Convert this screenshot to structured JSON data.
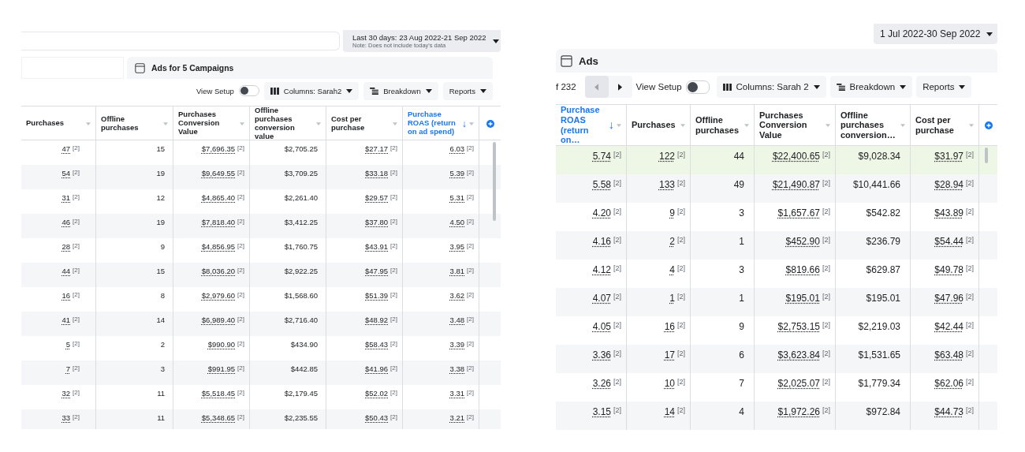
{
  "panels": [
    {
      "date_range": {
        "label": "Last 30 days: 23 Aug 2022-21 Sep 2022",
        "note": "Note: Does not include today's data"
      },
      "title": "Ads for 5 Campaigns",
      "view_setup": {
        "label": "View Setup",
        "on": false
      },
      "buttons": [
        "Columns: Sarah2",
        "Breakdown",
        "Reports"
      ],
      "columns": [
        {
          "label": "Purchases",
          "sorted": false
        },
        {
          "label": "Offline purchases",
          "sorted": false
        },
        {
          "label": "Purchases Conversion Value",
          "sorted": false
        },
        {
          "label": "Offline purchases conversion value",
          "sorted": false
        },
        {
          "label": "Cost per purchase",
          "sorted": false
        },
        {
          "label": "Purchase ROAS (return on ad spend)",
          "sorted": true,
          "arrow": "↓"
        }
      ],
      "rows": [
        {
          "selected": false,
          "cells": [
            {
              "v": "47",
              "n": "[2]"
            },
            {
              "v": "15"
            },
            {
              "v": "$7,696.35",
              "n": "[2]"
            },
            {
              "v": "$2,705.25"
            },
            {
              "v": "$27.17",
              "n": "[2]"
            },
            {
              "v": "6.03",
              "n": "[2]"
            }
          ]
        },
        {
          "selected": false,
          "cells": [
            {
              "v": "54",
              "n": "[2]"
            },
            {
              "v": "19"
            },
            {
              "v": "$9,649.55",
              "n": "[2]"
            },
            {
              "v": "$3,709.25"
            },
            {
              "v": "$33.18",
              "n": "[2]"
            },
            {
              "v": "5.39",
              "n": "[2]"
            }
          ]
        },
        {
          "selected": false,
          "cells": [
            {
              "v": "31",
              "n": "[2]"
            },
            {
              "v": "12"
            },
            {
              "v": "$4,865.40",
              "n": "[2]"
            },
            {
              "v": "$2,261.40"
            },
            {
              "v": "$29.57",
              "n": "[2]"
            },
            {
              "v": "5.31",
              "n": "[2]"
            }
          ]
        },
        {
          "selected": false,
          "cells": [
            {
              "v": "46",
              "n": "[2]"
            },
            {
              "v": "19"
            },
            {
              "v": "$7,818.40",
              "n": "[2]"
            },
            {
              "v": "$3,412.25"
            },
            {
              "v": "$37.80",
              "n": "[2]"
            },
            {
              "v": "4.50",
              "n": "[2]"
            }
          ]
        },
        {
          "selected": false,
          "cells": [
            {
              "v": "28",
              "n": "[2]"
            },
            {
              "v": "9"
            },
            {
              "v": "$4,856.95",
              "n": "[2]"
            },
            {
              "v": "$1,760.75"
            },
            {
              "v": "$43.91",
              "n": "[2]"
            },
            {
              "v": "3.95",
              "n": "[2]"
            }
          ]
        },
        {
          "selected": false,
          "cells": [
            {
              "v": "44",
              "n": "[2]"
            },
            {
              "v": "15"
            },
            {
              "v": "$8,036.20",
              "n": "[2]"
            },
            {
              "v": "$2,922.25"
            },
            {
              "v": "$47.95",
              "n": "[2]"
            },
            {
              "v": "3.81",
              "n": "[2]"
            }
          ]
        },
        {
          "selected": false,
          "cells": [
            {
              "v": "16",
              "n": "[2]"
            },
            {
              "v": "8"
            },
            {
              "v": "$2,979.60",
              "n": "[2]"
            },
            {
              "v": "$1,568.60"
            },
            {
              "v": "$51.39",
              "n": "[2]"
            },
            {
              "v": "3.62",
              "n": "[2]"
            }
          ]
        },
        {
          "selected": false,
          "cells": [
            {
              "v": "41",
              "n": "[2]"
            },
            {
              "v": "14"
            },
            {
              "v": "$6,989.40",
              "n": "[2]"
            },
            {
              "v": "$2,716.40"
            },
            {
              "v": "$48.92",
              "n": "[2]"
            },
            {
              "v": "3.48",
              "n": "[2]"
            }
          ]
        },
        {
          "selected": false,
          "cells": [
            {
              "v": "5",
              "n": "[2]"
            },
            {
              "v": "2"
            },
            {
              "v": "$990.90",
              "n": "[2]"
            },
            {
              "v": "$434.90"
            },
            {
              "v": "$58.43",
              "n": "[2]"
            },
            {
              "v": "3.39",
              "n": "[2]"
            }
          ]
        },
        {
          "selected": false,
          "cells": [
            {
              "v": "7",
              "n": "[2]"
            },
            {
              "v": "3"
            },
            {
              "v": "$991.95",
              "n": "[2]"
            },
            {
              "v": "$442.85"
            },
            {
              "v": "$41.96",
              "n": "[2]"
            },
            {
              "v": "3.38",
              "n": "[2]"
            }
          ]
        },
        {
          "selected": false,
          "cells": [
            {
              "v": "32",
              "n": "[2]"
            },
            {
              "v": "11"
            },
            {
              "v": "$5,518.45",
              "n": "[2]"
            },
            {
              "v": "$2,179.45"
            },
            {
              "v": "$52.02",
              "n": "[2]"
            },
            {
              "v": "3.31",
              "n": "[2]"
            }
          ]
        },
        {
          "selected": false,
          "cells": [
            {
              "v": "33",
              "n": "[2]"
            },
            {
              "v": "11"
            },
            {
              "v": "$5,348.65",
              "n": "[2]"
            },
            {
              "v": "$2,235.55"
            },
            {
              "v": "$50.43",
              "n": "[2]"
            },
            {
              "v": "3.21",
              "n": "[2]"
            }
          ]
        }
      ]
    },
    {
      "date_range": {
        "label": "1 Jul 2022-30 Sep 2022"
      },
      "title": "Ads",
      "pager": {
        "label": "f 232",
        "prev_disabled": true
      },
      "view_setup": {
        "label": "View Setup",
        "on": false
      },
      "buttons": [
        "Columns: Sarah 2",
        "Breakdown",
        "Reports"
      ],
      "columns": [
        {
          "label": "Purchase ROAS (return on…",
          "sorted": true,
          "arrow": "↓"
        },
        {
          "label": "Purchases",
          "sorted": false
        },
        {
          "label": "Offline purchases",
          "sorted": false
        },
        {
          "label": "Purchases Conversion Value",
          "sorted": false
        },
        {
          "label": "Offline purchases conversion…",
          "sorted": false
        },
        {
          "label": "Cost per purchase",
          "sorted": false
        }
      ],
      "rows": [
        {
          "selected": true,
          "cells": [
            {
              "v": "5.74",
              "n": "[2]"
            },
            {
              "v": "122",
              "n": "[2]"
            },
            {
              "v": "44"
            },
            {
              "v": "$22,400.65",
              "n": "[2]"
            },
            {
              "v": "$9,028.34"
            },
            {
              "v": "$31.97",
              "n": "[2]"
            }
          ]
        },
        {
          "selected": false,
          "cells": [
            {
              "v": "5.58",
              "n": "[2]"
            },
            {
              "v": "133",
              "n": "[2]"
            },
            {
              "v": "49"
            },
            {
              "v": "$21,490.87",
              "n": "[2]"
            },
            {
              "v": "$10,441.66"
            },
            {
              "v": "$28.94",
              "n": "[2]"
            }
          ]
        },
        {
          "selected": false,
          "cells": [
            {
              "v": "4.20",
              "n": "[2]"
            },
            {
              "v": "9",
              "n": "[2]"
            },
            {
              "v": "3"
            },
            {
              "v": "$1,657.67",
              "n": "[2]"
            },
            {
              "v": "$542.82"
            },
            {
              "v": "$43.89",
              "n": "[2]"
            }
          ]
        },
        {
          "selected": false,
          "cells": [
            {
              "v": "4.16",
              "n": "[2]"
            },
            {
              "v": "2",
              "n": "[2]"
            },
            {
              "v": "1"
            },
            {
              "v": "$452.90",
              "n": "[2]"
            },
            {
              "v": "$236.79"
            },
            {
              "v": "$54.44",
              "n": "[2]"
            }
          ]
        },
        {
          "selected": false,
          "cells": [
            {
              "v": "4.12",
              "n": "[2]"
            },
            {
              "v": "4",
              "n": "[2]"
            },
            {
              "v": "3"
            },
            {
              "v": "$819.66",
              "n": "[2]"
            },
            {
              "v": "$629.87"
            },
            {
              "v": "$49.78",
              "n": "[2]"
            }
          ]
        },
        {
          "selected": false,
          "cells": [
            {
              "v": "4.07",
              "n": "[2]"
            },
            {
              "v": "1",
              "n": "[2]"
            },
            {
              "v": "1"
            },
            {
              "v": "$195.01",
              "n": "[2]"
            },
            {
              "v": "$195.01"
            },
            {
              "v": "$47.96",
              "n": "[2]"
            }
          ]
        },
        {
          "selected": false,
          "cells": [
            {
              "v": "4.05",
              "n": "[2]"
            },
            {
              "v": "16",
              "n": "[2]"
            },
            {
              "v": "9"
            },
            {
              "v": "$2,753.15",
              "n": "[2]"
            },
            {
              "v": "$2,219.03"
            },
            {
              "v": "$42.44",
              "n": "[2]"
            }
          ]
        },
        {
          "selected": false,
          "cells": [
            {
              "v": "3.36",
              "n": "[2]"
            },
            {
              "v": "17",
              "n": "[2]"
            },
            {
              "v": "6"
            },
            {
              "v": "$3,623.84",
              "n": "[2]"
            },
            {
              "v": "$1,531.65"
            },
            {
              "v": "$63.48",
              "n": "[2]"
            }
          ]
        },
        {
          "selected": false,
          "cells": [
            {
              "v": "3.26",
              "n": "[2]"
            },
            {
              "v": "10",
              "n": "[2]"
            },
            {
              "v": "7"
            },
            {
              "v": "$2,025.07",
              "n": "[2]"
            },
            {
              "v": "$1,779.34"
            },
            {
              "v": "$62.06",
              "n": "[2]"
            }
          ]
        },
        {
          "selected": false,
          "cells": [
            {
              "v": "3.15",
              "n": "[2]"
            },
            {
              "v": "14",
              "n": "[2]"
            },
            {
              "v": "4"
            },
            {
              "v": "$1,972.26",
              "n": "[2]"
            },
            {
              "v": "$972.84"
            },
            {
              "v": "$44.73",
              "n": "[2]"
            }
          ]
        }
      ]
    }
  ]
}
